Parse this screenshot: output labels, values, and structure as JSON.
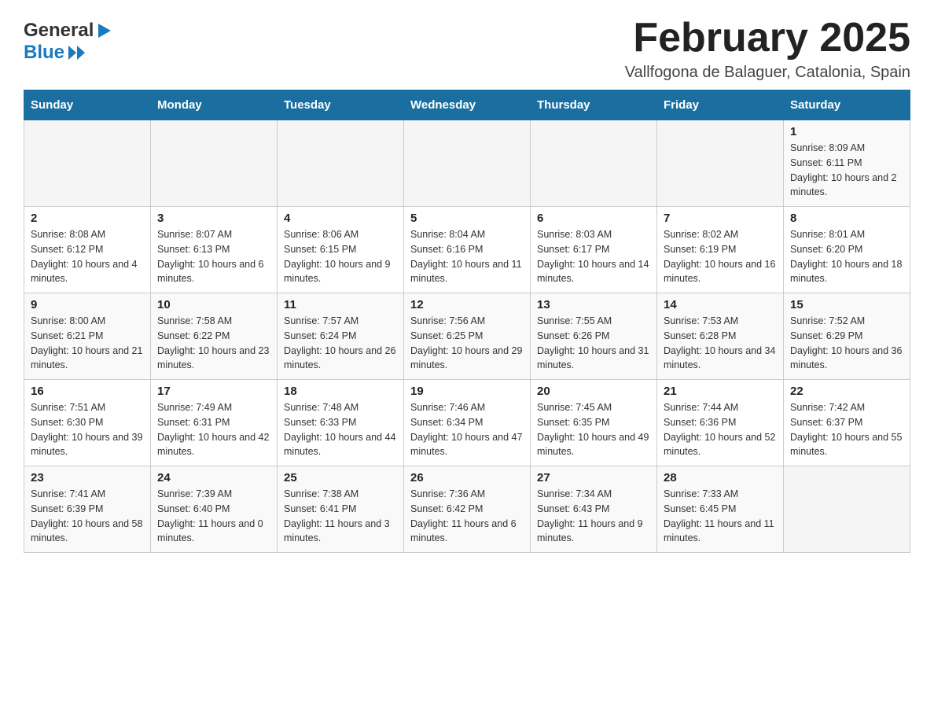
{
  "header": {
    "title": "February 2025",
    "location": "Vallfogona de Balaguer, Catalonia, Spain",
    "logo_general": "General",
    "logo_blue": "Blue"
  },
  "weekdays": [
    "Sunday",
    "Monday",
    "Tuesday",
    "Wednesday",
    "Thursday",
    "Friday",
    "Saturday"
  ],
  "weeks": [
    [
      {
        "day": "",
        "info": ""
      },
      {
        "day": "",
        "info": ""
      },
      {
        "day": "",
        "info": ""
      },
      {
        "day": "",
        "info": ""
      },
      {
        "day": "",
        "info": ""
      },
      {
        "day": "",
        "info": ""
      },
      {
        "day": "1",
        "info": "Sunrise: 8:09 AM\nSunset: 6:11 PM\nDaylight: 10 hours and 2 minutes."
      }
    ],
    [
      {
        "day": "2",
        "info": "Sunrise: 8:08 AM\nSunset: 6:12 PM\nDaylight: 10 hours and 4 minutes."
      },
      {
        "day": "3",
        "info": "Sunrise: 8:07 AM\nSunset: 6:13 PM\nDaylight: 10 hours and 6 minutes."
      },
      {
        "day": "4",
        "info": "Sunrise: 8:06 AM\nSunset: 6:15 PM\nDaylight: 10 hours and 9 minutes."
      },
      {
        "day": "5",
        "info": "Sunrise: 8:04 AM\nSunset: 6:16 PM\nDaylight: 10 hours and 11 minutes."
      },
      {
        "day": "6",
        "info": "Sunrise: 8:03 AM\nSunset: 6:17 PM\nDaylight: 10 hours and 14 minutes."
      },
      {
        "day": "7",
        "info": "Sunrise: 8:02 AM\nSunset: 6:19 PM\nDaylight: 10 hours and 16 minutes."
      },
      {
        "day": "8",
        "info": "Sunrise: 8:01 AM\nSunset: 6:20 PM\nDaylight: 10 hours and 18 minutes."
      }
    ],
    [
      {
        "day": "9",
        "info": "Sunrise: 8:00 AM\nSunset: 6:21 PM\nDaylight: 10 hours and 21 minutes."
      },
      {
        "day": "10",
        "info": "Sunrise: 7:58 AM\nSunset: 6:22 PM\nDaylight: 10 hours and 23 minutes."
      },
      {
        "day": "11",
        "info": "Sunrise: 7:57 AM\nSunset: 6:24 PM\nDaylight: 10 hours and 26 minutes."
      },
      {
        "day": "12",
        "info": "Sunrise: 7:56 AM\nSunset: 6:25 PM\nDaylight: 10 hours and 29 minutes."
      },
      {
        "day": "13",
        "info": "Sunrise: 7:55 AM\nSunset: 6:26 PM\nDaylight: 10 hours and 31 minutes."
      },
      {
        "day": "14",
        "info": "Sunrise: 7:53 AM\nSunset: 6:28 PM\nDaylight: 10 hours and 34 minutes."
      },
      {
        "day": "15",
        "info": "Sunrise: 7:52 AM\nSunset: 6:29 PM\nDaylight: 10 hours and 36 minutes."
      }
    ],
    [
      {
        "day": "16",
        "info": "Sunrise: 7:51 AM\nSunset: 6:30 PM\nDaylight: 10 hours and 39 minutes."
      },
      {
        "day": "17",
        "info": "Sunrise: 7:49 AM\nSunset: 6:31 PM\nDaylight: 10 hours and 42 minutes."
      },
      {
        "day": "18",
        "info": "Sunrise: 7:48 AM\nSunset: 6:33 PM\nDaylight: 10 hours and 44 minutes."
      },
      {
        "day": "19",
        "info": "Sunrise: 7:46 AM\nSunset: 6:34 PM\nDaylight: 10 hours and 47 minutes."
      },
      {
        "day": "20",
        "info": "Sunrise: 7:45 AM\nSunset: 6:35 PM\nDaylight: 10 hours and 49 minutes."
      },
      {
        "day": "21",
        "info": "Sunrise: 7:44 AM\nSunset: 6:36 PM\nDaylight: 10 hours and 52 minutes."
      },
      {
        "day": "22",
        "info": "Sunrise: 7:42 AM\nSunset: 6:37 PM\nDaylight: 10 hours and 55 minutes."
      }
    ],
    [
      {
        "day": "23",
        "info": "Sunrise: 7:41 AM\nSunset: 6:39 PM\nDaylight: 10 hours and 58 minutes."
      },
      {
        "day": "24",
        "info": "Sunrise: 7:39 AM\nSunset: 6:40 PM\nDaylight: 11 hours and 0 minutes."
      },
      {
        "day": "25",
        "info": "Sunrise: 7:38 AM\nSunset: 6:41 PM\nDaylight: 11 hours and 3 minutes."
      },
      {
        "day": "26",
        "info": "Sunrise: 7:36 AM\nSunset: 6:42 PM\nDaylight: 11 hours and 6 minutes."
      },
      {
        "day": "27",
        "info": "Sunrise: 7:34 AM\nSunset: 6:43 PM\nDaylight: 11 hours and 9 minutes."
      },
      {
        "day": "28",
        "info": "Sunrise: 7:33 AM\nSunset: 6:45 PM\nDaylight: 11 hours and 11 minutes."
      },
      {
        "day": "",
        "info": ""
      }
    ]
  ]
}
